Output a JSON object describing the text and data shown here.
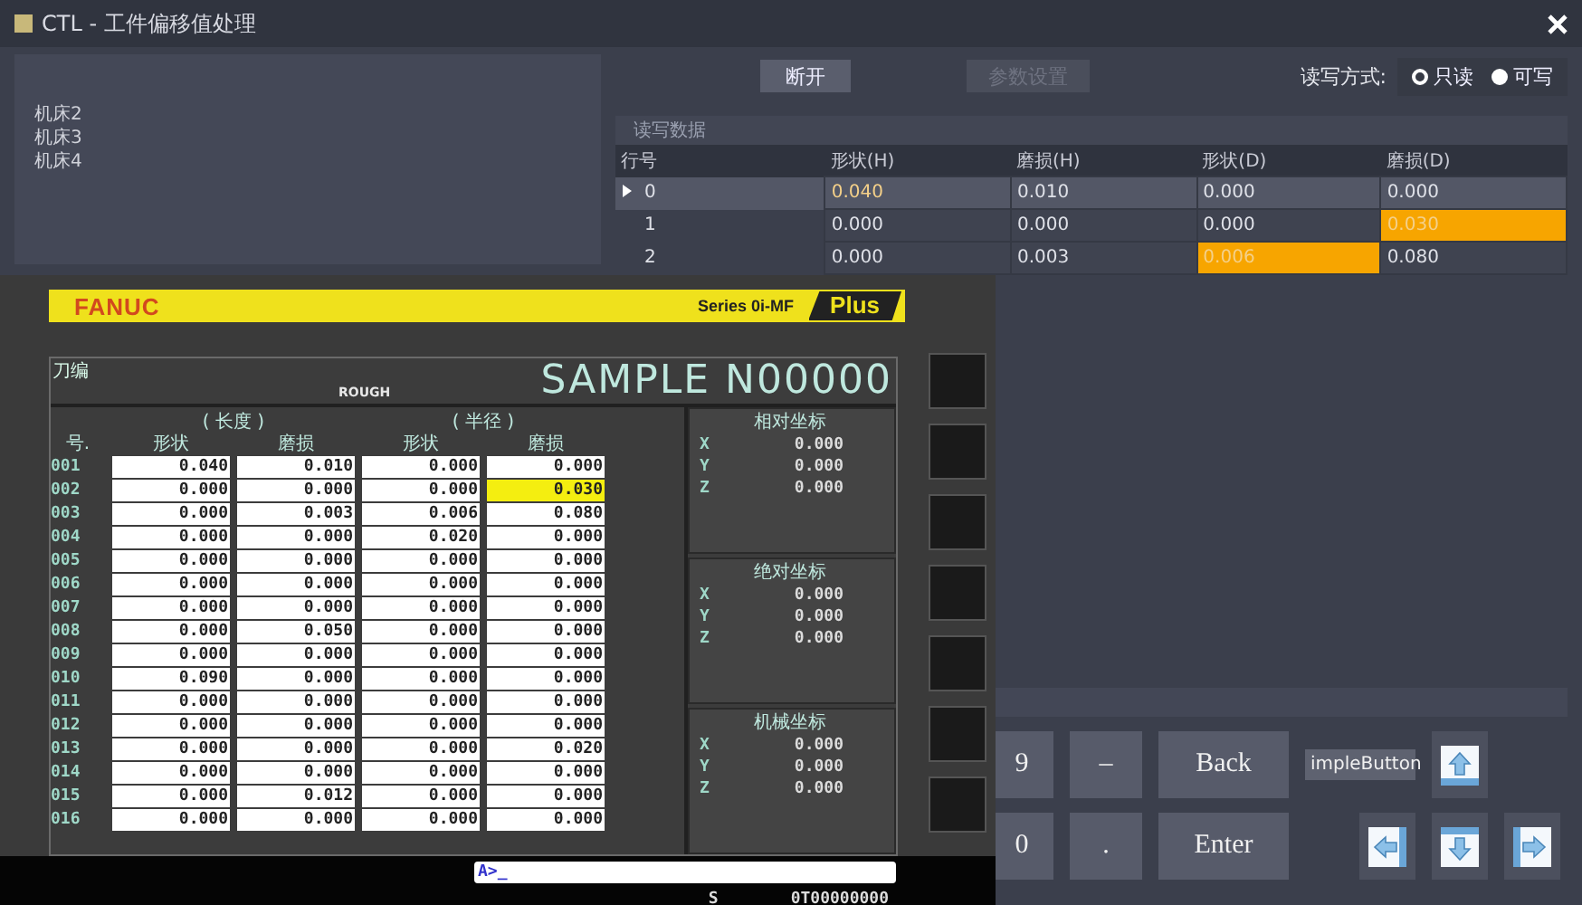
{
  "window": {
    "title": "CTL - 工件偏移值处理"
  },
  "sidebar": {
    "items": [
      {
        "label": "机床2",
        "selected": false
      },
      {
        "label": "机床3",
        "selected": false
      },
      {
        "label": "机床4",
        "selected": false
      }
    ]
  },
  "toolbar": {
    "buttons": [
      {
        "label": "断开",
        "disabled": false
      },
      {
        "label": "参数设置",
        "disabled": true
      }
    ],
    "mode_label": "读写方式:",
    "modes": [
      {
        "label": "只读",
        "selected": true
      },
      {
        "label": "可写",
        "selected": false
      }
    ]
  },
  "data_group": {
    "title": "读写数据",
    "columns": [
      "行号",
      "形状(H)",
      "磨损(H)",
      "形状(D)",
      "磨损(D)"
    ],
    "rows": [
      {
        "selected": true,
        "cells": [
          {
            "value": "0",
            "highlighted": false
          },
          {
            "value": "0.040",
            "highlighted": true
          },
          {
            "value": "0.010",
            "highlighted": false
          },
          {
            "value": "0.000",
            "highlighted": false
          },
          {
            "value": "0.000",
            "highlighted": false
          }
        ]
      },
      {
        "selected": false,
        "cells": [
          {
            "value": "1",
            "highlighted": false
          },
          {
            "value": "0.000",
            "highlighted": false
          },
          {
            "value": "0.000",
            "highlighted": false
          },
          {
            "value": "0.000",
            "highlighted": false
          },
          {
            "value": "0.030",
            "highlighted": true
          }
        ]
      },
      {
        "selected": false,
        "cells": [
          {
            "value": "2",
            "highlighted": false
          },
          {
            "value": "0.000",
            "highlighted": false
          },
          {
            "value": "0.003",
            "highlighted": false
          },
          {
            "value": "0.006",
            "highlighted": true
          },
          {
            "value": "0.080",
            "highlighted": false
          }
        ]
      }
    ]
  },
  "keypad": {
    "keys": [
      {
        "kind": "key",
        "label": "9"
      },
      {
        "kind": "key",
        "label": "–"
      },
      {
        "kind": "key",
        "label": "Back"
      },
      {
        "kind": "small",
        "label": "impleButton"
      },
      {
        "kind": "up"
      },
      {
        "kind": "blank"
      },
      {
        "kind": "key",
        "label": "0"
      },
      {
        "kind": "key",
        "label": "."
      },
      {
        "kind": "key",
        "label": "Enter"
      },
      {
        "kind": "left"
      },
      {
        "kind": "down"
      },
      {
        "kind": "right"
      }
    ]
  },
  "fanuc": {
    "brand": "FANUC",
    "series": "Series 0i-MF",
    "edition": "Plus",
    "screen_title": "刀编",
    "mode": "ROUGH",
    "program": "SAMPLE N00000",
    "group_headers": [
      "( 长度 )",
      "( 半径 )"
    ],
    "columns": [
      "号.",
      "形状",
      "磨损",
      "形状",
      "磨损"
    ],
    "rows": [
      {
        "number": "001",
        "values": [
          {
            "value": "0.040",
            "highlighted": false
          },
          {
            "value": "0.010",
            "highlighted": false
          },
          {
            "value": "0.000",
            "highlighted": false
          },
          {
            "value": "0.000",
            "highlighted": false
          }
        ]
      },
      {
        "number": "002",
        "values": [
          {
            "value": "0.000",
            "highlighted": false
          },
          {
            "value": "0.000",
            "highlighted": false
          },
          {
            "value": "0.000",
            "highlighted": false
          },
          {
            "value": "0.030",
            "highlighted": true
          }
        ]
      },
      {
        "number": "003",
        "values": [
          {
            "value": "0.000",
            "highlighted": false
          },
          {
            "value": "0.003",
            "highlighted": false
          },
          {
            "value": "0.006",
            "highlighted": false
          },
          {
            "value": "0.080",
            "highlighted": false
          }
        ]
      },
      {
        "number": "004",
        "values": [
          {
            "value": "0.000",
            "highlighted": false
          },
          {
            "value": "0.000",
            "highlighted": false
          },
          {
            "value": "0.020",
            "highlighted": false
          },
          {
            "value": "0.000",
            "highlighted": false
          }
        ]
      },
      {
        "number": "005",
        "values": [
          {
            "value": "0.000",
            "highlighted": false
          },
          {
            "value": "0.000",
            "highlighted": false
          },
          {
            "value": "0.000",
            "highlighted": false
          },
          {
            "value": "0.000",
            "highlighted": false
          }
        ]
      },
      {
        "number": "006",
        "values": [
          {
            "value": "0.000",
            "highlighted": false
          },
          {
            "value": "0.000",
            "highlighted": false
          },
          {
            "value": "0.000",
            "highlighted": false
          },
          {
            "value": "0.000",
            "highlighted": false
          }
        ]
      },
      {
        "number": "007",
        "values": [
          {
            "value": "0.000",
            "highlighted": false
          },
          {
            "value": "0.000",
            "highlighted": false
          },
          {
            "value": "0.000",
            "highlighted": false
          },
          {
            "value": "0.000",
            "highlighted": false
          }
        ]
      },
      {
        "number": "008",
        "values": [
          {
            "value": "0.000",
            "highlighted": false
          },
          {
            "value": "0.050",
            "highlighted": false
          },
          {
            "value": "0.000",
            "highlighted": false
          },
          {
            "value": "0.000",
            "highlighted": false
          }
        ]
      },
      {
        "number": "009",
        "values": [
          {
            "value": "0.000",
            "highlighted": false
          },
          {
            "value": "0.000",
            "highlighted": false
          },
          {
            "value": "0.000",
            "highlighted": false
          },
          {
            "value": "0.000",
            "highlighted": false
          }
        ]
      },
      {
        "number": "010",
        "values": [
          {
            "value": "0.090",
            "highlighted": false
          },
          {
            "value": "0.000",
            "highlighted": false
          },
          {
            "value": "0.000",
            "highlighted": false
          },
          {
            "value": "0.000",
            "highlighted": false
          }
        ]
      },
      {
        "number": "011",
        "values": [
          {
            "value": "0.000",
            "highlighted": false
          },
          {
            "value": "0.000",
            "highlighted": false
          },
          {
            "value": "0.000",
            "highlighted": false
          },
          {
            "value": "0.000",
            "highlighted": false
          }
        ]
      },
      {
        "number": "012",
        "values": [
          {
            "value": "0.000",
            "highlighted": false
          },
          {
            "value": "0.000",
            "highlighted": false
          },
          {
            "value": "0.000",
            "highlighted": false
          },
          {
            "value": "0.000",
            "highlighted": false
          }
        ]
      },
      {
        "number": "013",
        "values": [
          {
            "value": "0.000",
            "highlighted": false
          },
          {
            "value": "0.000",
            "highlighted": false
          },
          {
            "value": "0.000",
            "highlighted": false
          },
          {
            "value": "0.020",
            "highlighted": false
          }
        ]
      },
      {
        "number": "014",
        "values": [
          {
            "value": "0.000",
            "highlighted": false
          },
          {
            "value": "0.000",
            "highlighted": false
          },
          {
            "value": "0.000",
            "highlighted": false
          },
          {
            "value": "0.000",
            "highlighted": false
          }
        ]
      },
      {
        "number": "015",
        "values": [
          {
            "value": "0.000",
            "highlighted": false
          },
          {
            "value": "0.012",
            "highlighted": false
          },
          {
            "value": "0.000",
            "highlighted": false
          },
          {
            "value": "0.000",
            "highlighted": false
          }
        ]
      },
      {
        "number": "016",
        "values": [
          {
            "value": "0.000",
            "highlighted": false
          },
          {
            "value": "0.000",
            "highlighted": false
          },
          {
            "value": "0.000",
            "highlighted": false
          },
          {
            "value": "0.000",
            "highlighted": false
          }
        ]
      }
    ],
    "coordinates": [
      {
        "title": "相对坐标",
        "axes": [
          {
            "axis": "X",
            "value": "0.000"
          },
          {
            "axis": "Y",
            "value": "0.000"
          },
          {
            "axis": "Z",
            "value": "0.000"
          }
        ]
      },
      {
        "title": "绝对坐标",
        "axes": [
          {
            "axis": "X",
            "value": "0.000"
          },
          {
            "axis": "Y",
            "value": "0.000"
          },
          {
            "axis": "Z",
            "value": "0.000"
          }
        ]
      },
      {
        "title": "机械坐标",
        "axes": [
          {
            "axis": "X",
            "value": "0.000"
          },
          {
            "axis": "Y",
            "value": "0.000"
          },
          {
            "axis": "Z",
            "value": "0.000"
          }
        ]
      }
    ],
    "input": "A>_",
    "status_label": "S",
    "status_value": "0T00000000"
  }
}
